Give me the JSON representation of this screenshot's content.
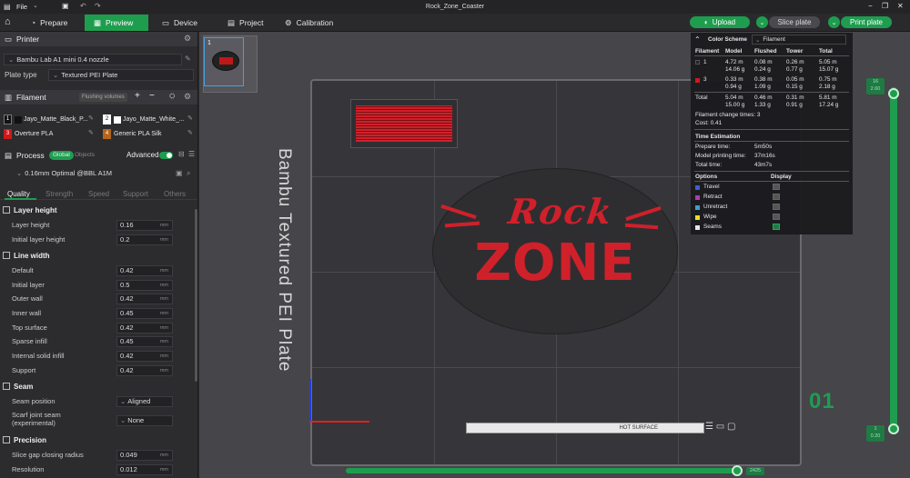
{
  "window": {
    "title": "Rock_Zone_Coaster",
    "menu_file": "File"
  },
  "toolbar": {
    "tabs": [
      {
        "label": "Prepare"
      },
      {
        "label": "Preview"
      },
      {
        "label": "Device"
      },
      {
        "label": "Project"
      },
      {
        "label": "Calibration"
      }
    ],
    "upload": "Upload",
    "slice": "Slice plate",
    "print": "Print plate"
  },
  "printer": {
    "header": "Printer",
    "name": "Bambu Lab A1 mini 0.4 nozzle",
    "plate_type_label": "Plate type",
    "plate_type": "Textured PEI Plate"
  },
  "filament": {
    "header": "Filament",
    "flushing": "Flushing volumes",
    "items": [
      {
        "num": "1",
        "name": "Jayo_Matte_Black_P...",
        "color": "#111111"
      },
      {
        "num": "2",
        "name": "Jayo_Matte_White_...",
        "color": "#ffffff"
      },
      {
        "num": "3",
        "name": "Overture PLA",
        "color": "#cc1a1a"
      },
      {
        "num": "4",
        "name": "Generic PLA Silk",
        "color": "#b5651d"
      }
    ]
  },
  "process": {
    "header": "Process",
    "global": "Global",
    "objects": "Objects",
    "advanced": "Advanced",
    "preset": "0.16mm Optimal @BBL A1M",
    "tabs": [
      "Quality",
      "Strength",
      "Speed",
      "Support",
      "Others"
    ]
  },
  "settings": {
    "layer_height": {
      "title": "Layer height",
      "rows": [
        {
          "label": "Layer height",
          "value": "0.16",
          "unit": "mm"
        },
        {
          "label": "Initial layer height",
          "value": "0.2",
          "unit": "mm"
        }
      ]
    },
    "line_width": {
      "title": "Line width",
      "rows": [
        {
          "label": "Default",
          "value": "0.42",
          "unit": "mm"
        },
        {
          "label": "Initial layer",
          "value": "0.5",
          "unit": "mm"
        },
        {
          "label": "Outer wall",
          "value": "0.42",
          "unit": "mm"
        },
        {
          "label": "Inner wall",
          "value": "0.45",
          "unit": "mm"
        },
        {
          "label": "Top surface",
          "value": "0.42",
          "unit": "mm"
        },
        {
          "label": "Sparse infill",
          "value": "0.45",
          "unit": "mm"
        },
        {
          "label": "Internal solid infill",
          "value": "0.42",
          "unit": "mm"
        },
        {
          "label": "Support",
          "value": "0.42",
          "unit": "mm"
        }
      ]
    },
    "seam": {
      "title": "Seam",
      "rows": [
        {
          "label": "Seam position",
          "value": "Aligned"
        },
        {
          "label": "Scarf joint seam",
          "label2": "(experimental)",
          "value": "None"
        }
      ]
    },
    "precision": {
      "title": "Precision",
      "rows": [
        {
          "label": "Slice gap closing radius",
          "value": "0.049",
          "unit": "mm"
        },
        {
          "label": "Resolution",
          "value": "0.012",
          "unit": "mm"
        }
      ]
    }
  },
  "stats": {
    "color_scheme": "Color Scheme",
    "scheme_value": "Filament",
    "headers": [
      "Filament",
      "Model",
      "Flushed",
      "Tower",
      "Total"
    ],
    "rows": [
      {
        "id": "1",
        "color": "#222222",
        "model": [
          "4.72 m",
          "14.06 g"
        ],
        "flushed": [
          "0.08 m",
          "0.24 g"
        ],
        "tower": [
          "0.26 m",
          "0.77 g"
        ],
        "total": [
          "5.05 m",
          "15.07 g"
        ]
      },
      {
        "id": "3",
        "color": "#cc1a1a",
        "model": [
          "0.33 m",
          "0.94 g"
        ],
        "flushed": [
          "0.38 m",
          "1.09 g"
        ],
        "tower": [
          "0.05 m",
          "0.15 g"
        ],
        "total": [
          "0.75 m",
          "2.18 g"
        ]
      }
    ],
    "total_row": {
      "label": "Total",
      "model": [
        "5.04 m",
        "15.00 g"
      ],
      "flushed": [
        "0.46 m",
        "1.33 g"
      ],
      "tower": [
        "0.31 m",
        "0.91 g"
      ],
      "total": [
        "5.81 m",
        "17.24 g"
      ]
    },
    "change_times": "Filament change times: 3",
    "cost": "Cost:  0.41",
    "time_header": "Time Estimation",
    "times": [
      {
        "label": "Prepare time:",
        "value": "5m50s"
      },
      {
        "label": "Model printing time:",
        "value": "37m16s"
      },
      {
        "label": "Total time:",
        "value": "43m7s"
      }
    ],
    "options_header": "Options",
    "display_header": "Display",
    "options": [
      {
        "label": "Travel",
        "color": "#3a5fd0",
        "checked": false
      },
      {
        "label": "Retract",
        "color": "#b03ab0",
        "checked": false
      },
      {
        "label": "Unretract",
        "color": "#3aa0d0",
        "checked": false
      },
      {
        "label": "Wipe",
        "color": "#e8e020",
        "checked": false
      },
      {
        "label": "Seams",
        "color": "#e6e6e6",
        "checked": true
      }
    ]
  },
  "viewport": {
    "plate_number": "1",
    "plate_text": "Bambu Textured PEI Plate",
    "model_line1": "Rock",
    "model_line2": "ZONE",
    "layer_big": "01",
    "slider_top": [
      "16",
      "2.60"
    ],
    "slider_bottom": [
      "1",
      "0.20"
    ],
    "h_slider_val": "2425",
    "plate_bottom_label": "HOT SURFACE"
  }
}
